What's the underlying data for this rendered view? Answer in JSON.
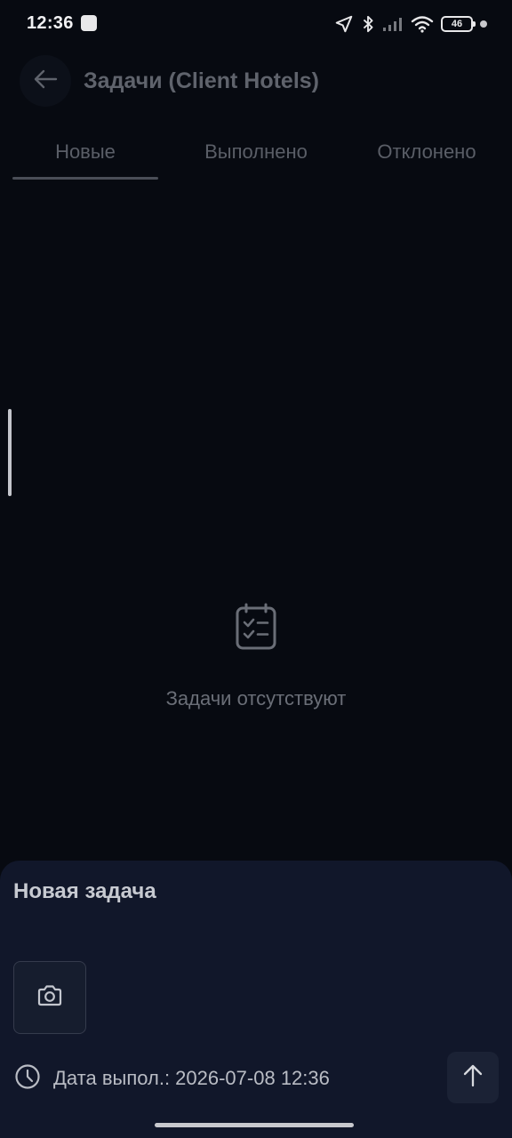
{
  "status_bar": {
    "time": "12:36",
    "battery_level": "46",
    "icons": [
      "app-notification-icon",
      "location-icon",
      "bluetooth-icon",
      "signal-icon",
      "wifi-icon",
      "battery-icon",
      "dot-icon"
    ]
  },
  "header": {
    "back_icon": "arrow-left-icon",
    "title": "Задачи (Client Hotels)"
  },
  "tabs": [
    {
      "label": "Новые",
      "active": true
    },
    {
      "label": "Выполнено",
      "active": false
    },
    {
      "label": "Отклонено",
      "active": false
    }
  ],
  "empty_state": {
    "icon": "clipboard-check-icon",
    "text": "Задачи отсутствуют"
  },
  "new_task_sheet": {
    "title": "Новая задача",
    "camera_icon": "camera-icon",
    "due_icon": "clock-icon",
    "due_label": "Дата выпол.: 2026-07-08 12:36",
    "send_icon": "arrow-up-icon"
  },
  "colors": {
    "background": "#070a11",
    "sheet": "#11172a",
    "muted_text": "#6a6e77"
  }
}
